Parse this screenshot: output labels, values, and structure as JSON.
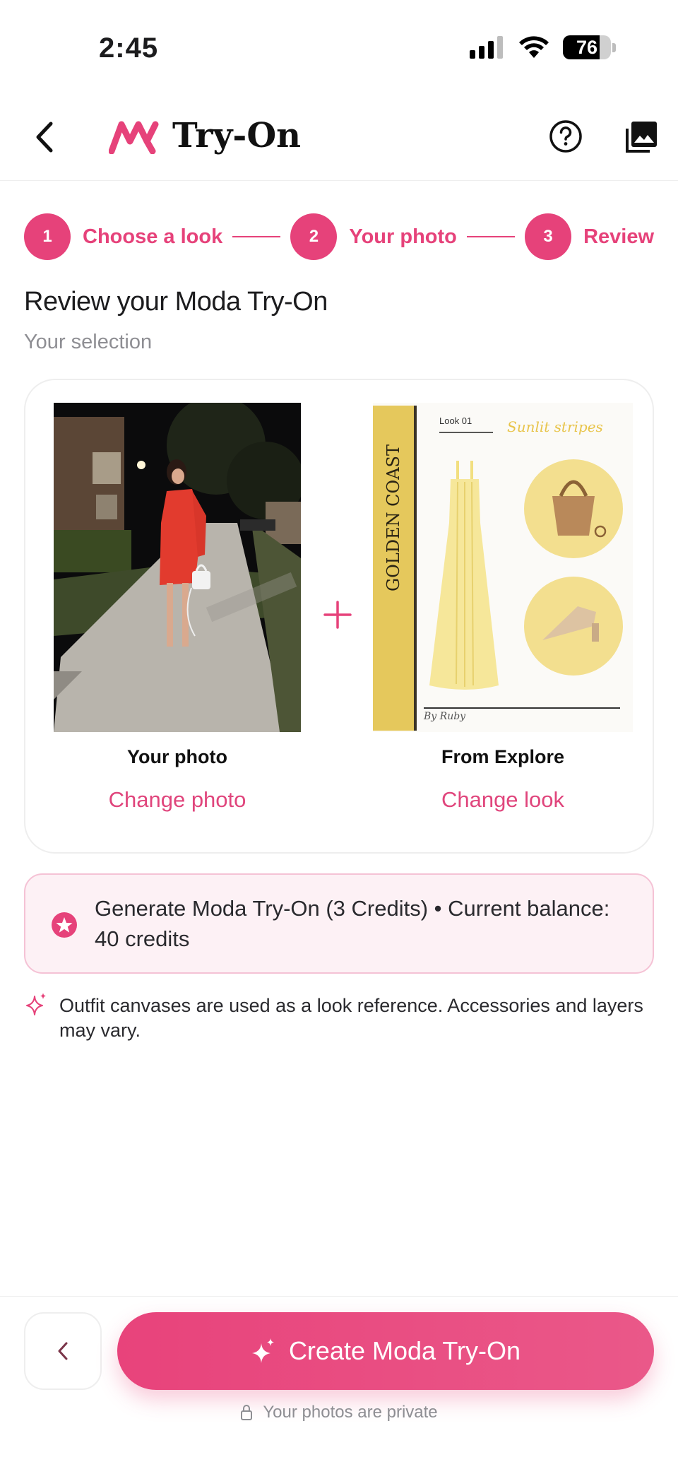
{
  "status_bar": {
    "time": "2:45",
    "battery_level": "76",
    "battery_fraction": 0.76
  },
  "header": {
    "title": "Try-On"
  },
  "stepper": {
    "steps": [
      {
        "number": "1",
        "label": "Choose a look"
      },
      {
        "number": "2",
        "label": "Your photo"
      },
      {
        "number": "3",
        "label": "Review"
      }
    ]
  },
  "page": {
    "title": "Review your Moda Try-On",
    "subtitle": "Your selection"
  },
  "selection": {
    "photo_caption": "Your photo",
    "photo_action": "Change photo",
    "look_caption": "From Explore",
    "look_action": "Change look",
    "look_card": {
      "side_title": "GOLDEN COAST",
      "tag": "Look 01",
      "script_title": "Sunlit stripes",
      "signature": "By Ruby"
    }
  },
  "credits": {
    "text": "Generate Moda Try-On (3 Credits)  •  Current balance: 40 credits"
  },
  "note": {
    "text": "Outfit canvases are used as a look reference. Accessories and layers may vary."
  },
  "bottom": {
    "create_label": "Create Moda Try-On",
    "privacy_text": "Your photos are private"
  },
  "colors": {
    "accent": "#e6427a",
    "banner_bg": "#fdf1f5",
    "dress_yellow": "#f6e79a",
    "gold_band": "#e5c85c"
  },
  "icons": [
    "back-arrow-icon",
    "moda-logo-icon",
    "help-icon",
    "gallery-icon",
    "plus-icon",
    "star-badge-icon",
    "sparkle-icon",
    "chevron-left-icon",
    "lock-icon"
  ]
}
